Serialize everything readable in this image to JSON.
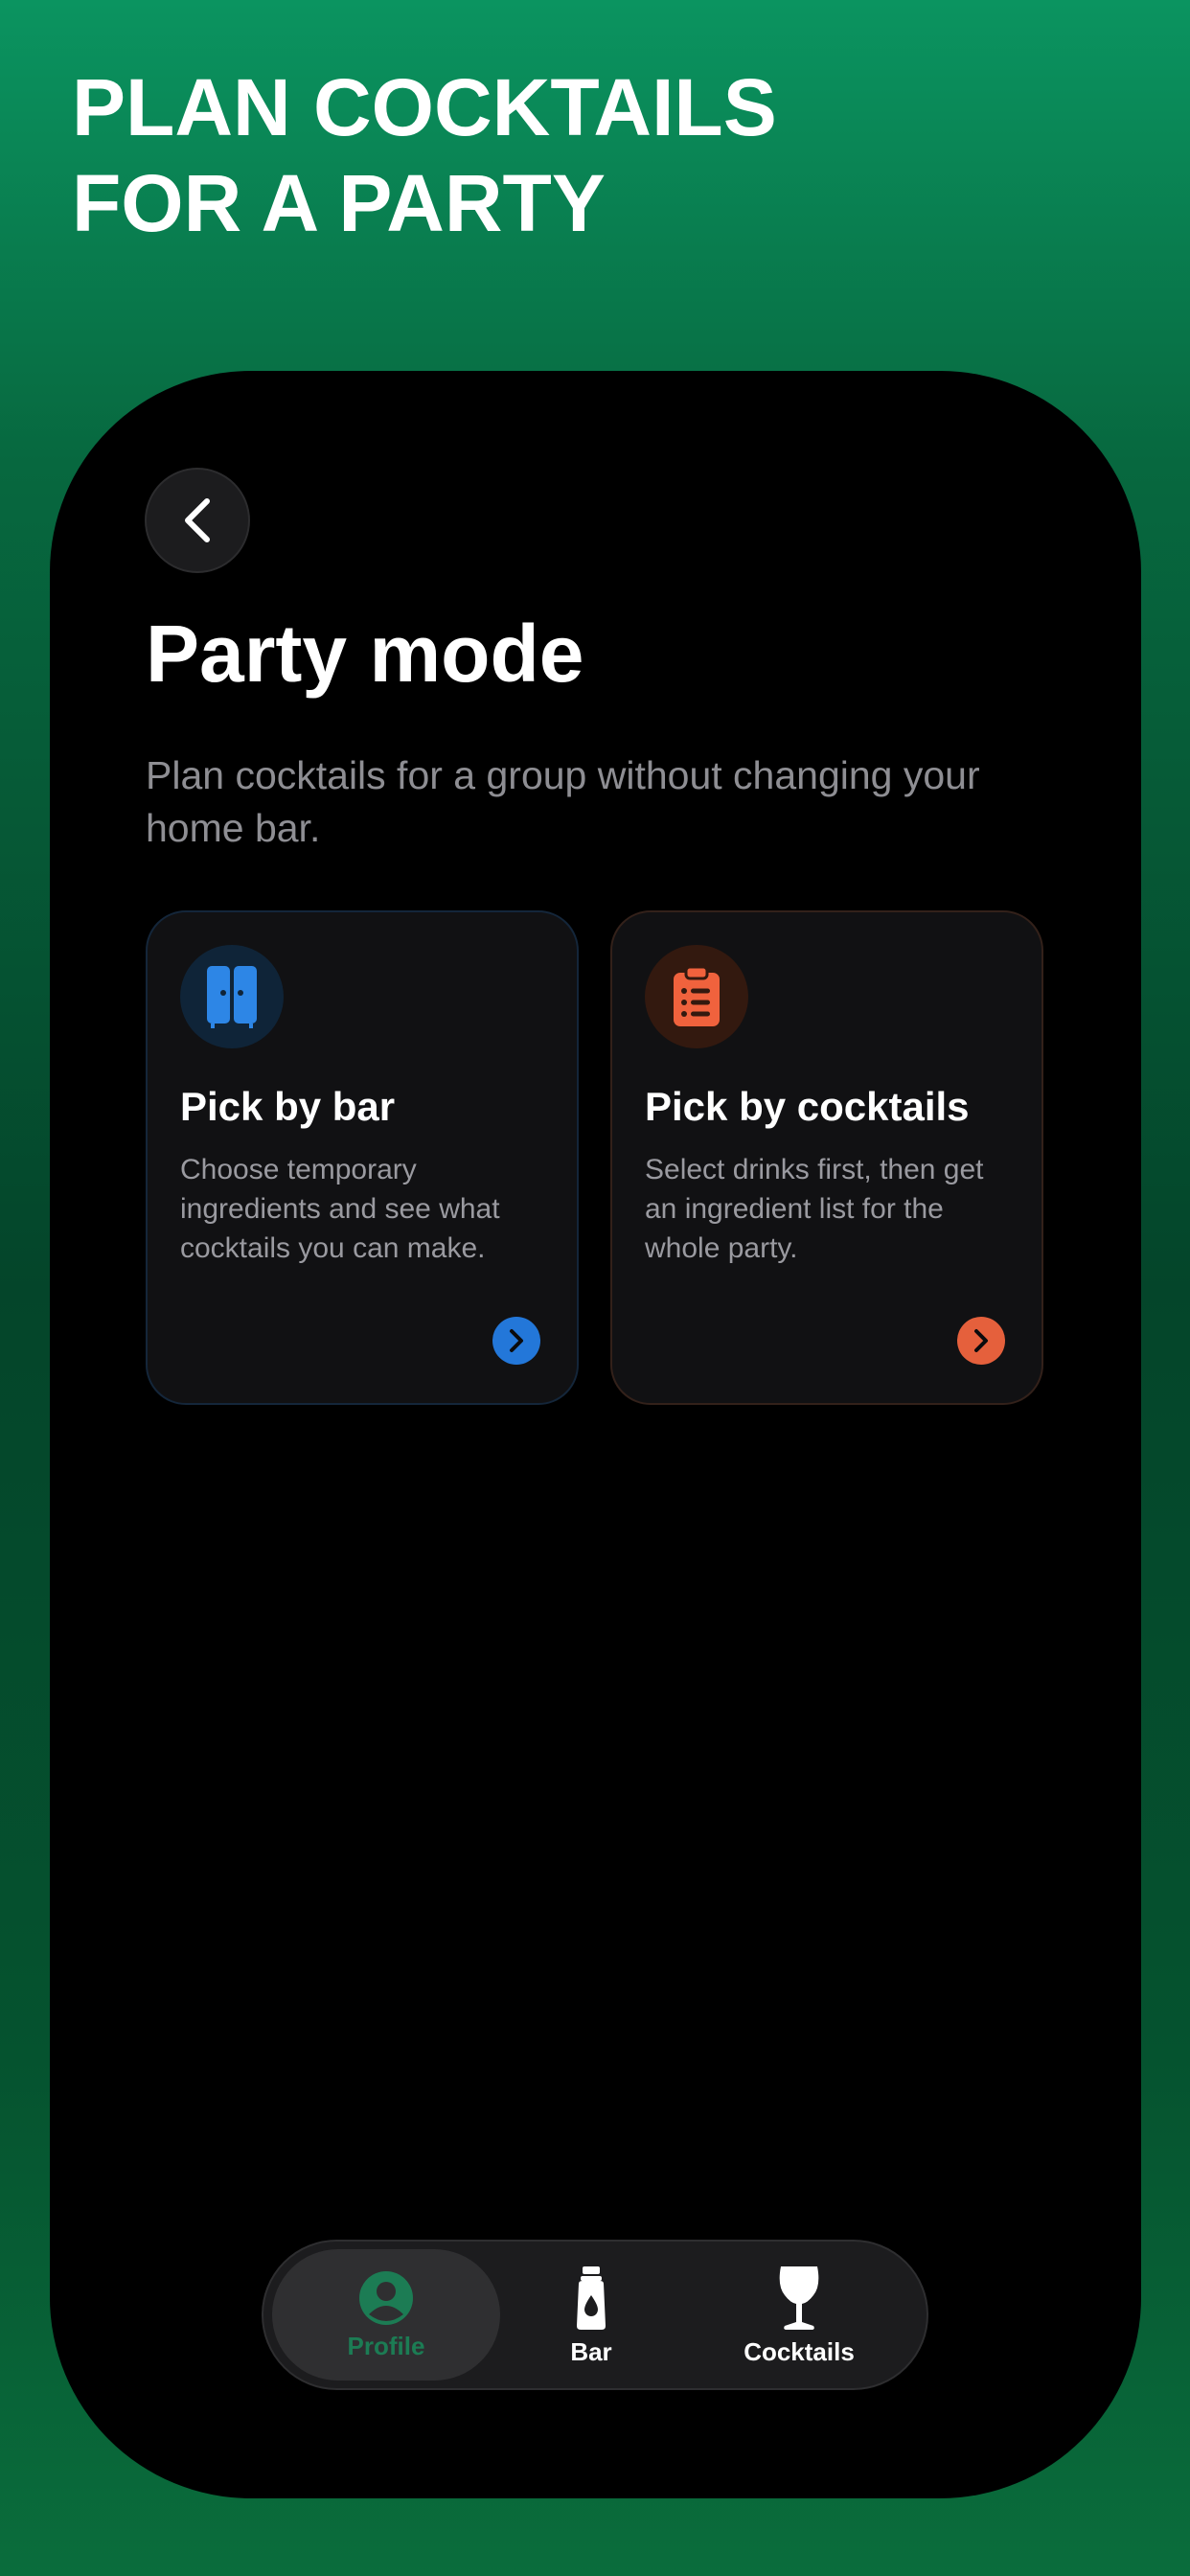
{
  "headline": {
    "line1": "PLAN COCKTAILS",
    "line2": "FOR A PARTY"
  },
  "screen": {
    "back_icon": "chevron-left-icon",
    "title": "Party mode",
    "subtitle": "Plan cocktails for a group without changing your home bar."
  },
  "cards": [
    {
      "icon": "cabinet-icon",
      "title": "Pick by bar",
      "description": "Choose temporary ingredients and see what cocktails you can make.",
      "accent": "#2377d9"
    },
    {
      "icon": "clipboard-list-icon",
      "title": "Pick by cocktails",
      "description": "Select drinks first, then get an ingredient list for the whole party.",
      "accent": "#e5603c"
    }
  ],
  "tabbar": {
    "selected": "Profile",
    "tabs": [
      {
        "label": "Profile",
        "icon": "profile-icon"
      },
      {
        "label": "Bar",
        "icon": "bottle-icon"
      },
      {
        "label": "Cocktails",
        "icon": "wine-glass-icon"
      }
    ]
  },
  "colors": {
    "background_top": "#0b9460",
    "background_bottom": "#04452a",
    "active_tab": "#1c7c54"
  }
}
